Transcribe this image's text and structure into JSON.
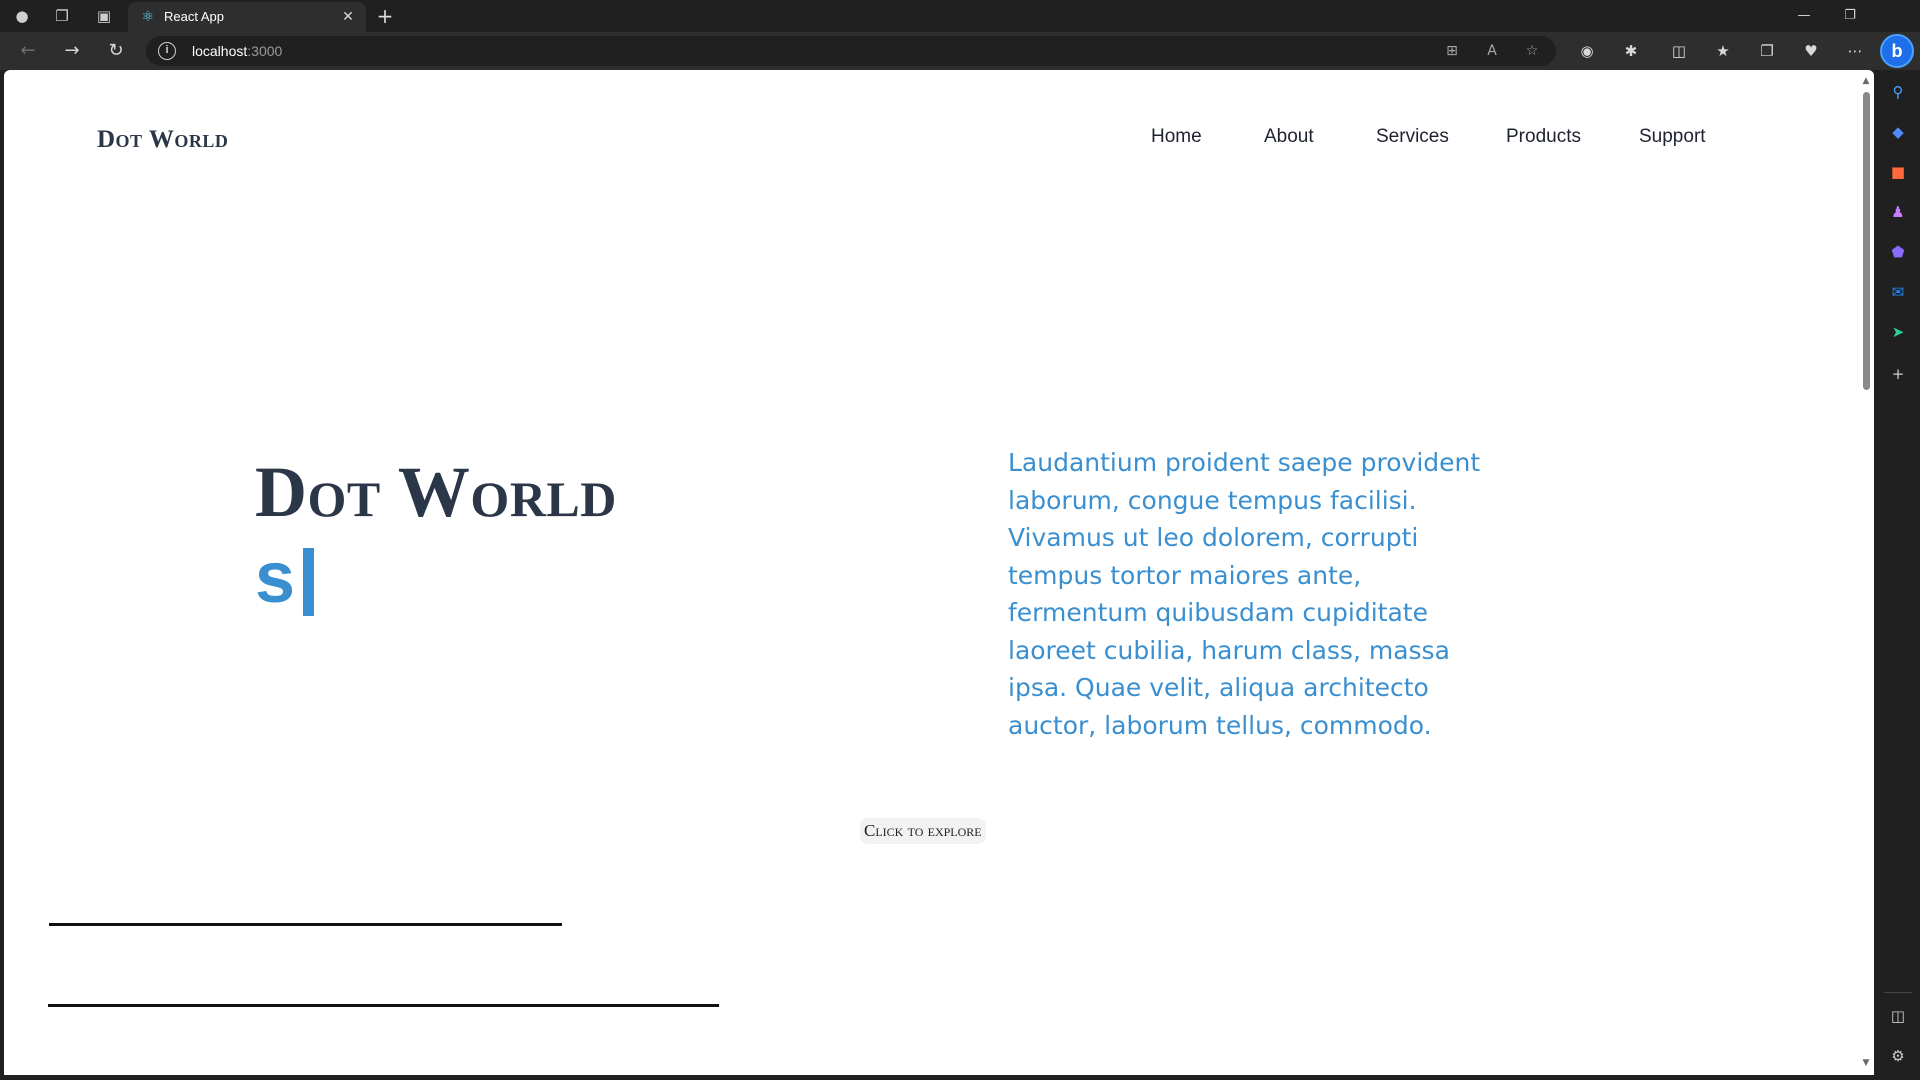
{
  "browser": {
    "tab": {
      "title": "React App"
    },
    "address": {
      "host": "localhost",
      "port": ":3000"
    },
    "sidebar_search": "b"
  },
  "page": {
    "logo": "Dot World",
    "nav": [
      "Home",
      "About",
      "Services",
      "Products",
      "Support"
    ],
    "hero": {
      "title": "Dot World",
      "typed": "s",
      "description": "Laudantium proident saepe provident laborum, congue tempus facilisi. Vivamus ut leo dolorem, corrupti tempus tortor maiores ante, fermentum quibusdam cupiditate laoreet cubilia, harum class, massa ipsa. Quae velit, aliqua architecto auctor, laborum tellus, commodo."
    },
    "explore_button": "Click to explore"
  },
  "colors": {
    "accent": "#3a8fd0",
    "heading": "#2b3648",
    "chrome_bg": "#202020",
    "toolbar_bg": "#2e2e2e"
  }
}
